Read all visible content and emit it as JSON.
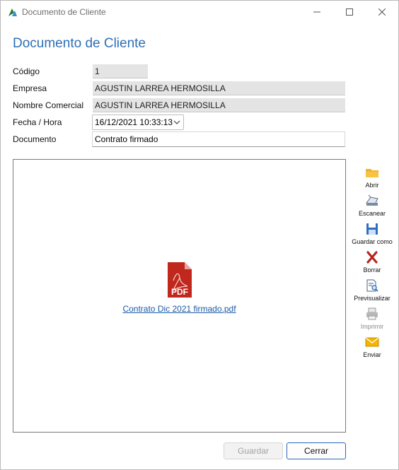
{
  "window": {
    "title": "Documento de Cliente",
    "controls": {
      "minimize_icon": "minimize-icon",
      "maximize_icon": "maximize-icon",
      "close_icon": "close-icon"
    }
  },
  "form": {
    "heading": "Documento de Cliente",
    "codigo": {
      "label": "Código",
      "value": "1"
    },
    "empresa": {
      "label": "Empresa",
      "value": "AGUSTIN LARREA HERMOSILLA"
    },
    "nombre_comercial": {
      "label": "Nombre Comercial",
      "value": "AGUSTIN LARREA HERMOSILLA"
    },
    "fecha_hora": {
      "label": "Fecha / Hora",
      "value": "16/12/2021 10:33:13"
    },
    "documento": {
      "label": "Documento",
      "value": "Contrato firmado"
    }
  },
  "preview": {
    "file_icon": "pdf-file-icon",
    "file_icon_text": "PDF",
    "file_name": "Contrato Dic 2021 firmado.pdf"
  },
  "toolbar": {
    "items": [
      {
        "label": "Abrir",
        "icon": "folder-icon",
        "enabled": true
      },
      {
        "label": "Escanear",
        "icon": "scanner-icon",
        "enabled": true
      },
      {
        "label": "Guardar como",
        "icon": "floppy-disk-icon",
        "enabled": true
      },
      {
        "label": "Borrar",
        "icon": "delete-x-icon",
        "enabled": true
      },
      {
        "label": "Previsualizar",
        "icon": "preview-document-icon",
        "enabled": true
      },
      {
        "label": "Imprimir",
        "icon": "printer-icon",
        "enabled": false
      },
      {
        "label": "Enviar",
        "icon": "envelope-icon",
        "enabled": true
      }
    ]
  },
  "buttons": {
    "save": {
      "label": "Guardar",
      "enabled": false
    },
    "close": {
      "label": "Cerrar",
      "enabled": true
    }
  },
  "colors": {
    "heading": "#2d6fb6",
    "link": "#1a5aa8",
    "readonly_bg": "#e4e4e4",
    "primary_border": "#2b66b7"
  }
}
